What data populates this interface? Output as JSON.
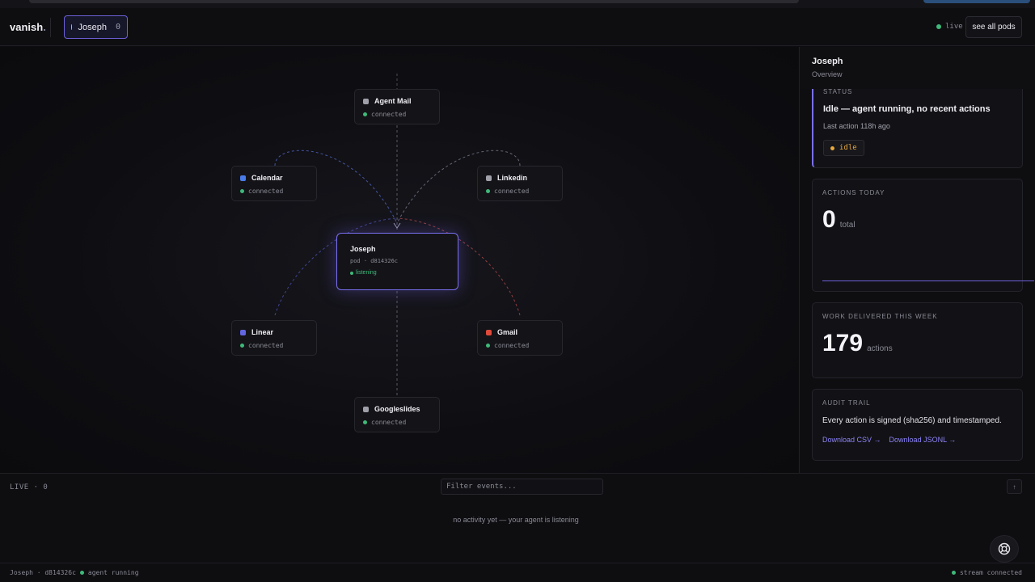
{
  "header": {
    "logo": "vanish",
    "logo_dot": ".",
    "pod_name": "Joseph",
    "pod_count": "0",
    "live_label": "live",
    "see_all_label": "see all pods"
  },
  "graph": {
    "center": {
      "title": "Joseph",
      "subtitle": "pod · d814326c",
      "state": "listening"
    },
    "nodes": [
      {
        "name": "Agent Mail",
        "status": "connected",
        "color": "#a0a0aa"
      },
      {
        "name": "Calendar",
        "status": "connected",
        "color": "#4a7ce8"
      },
      {
        "name": "Linkedin",
        "status": "connected",
        "color": "#a0a0aa"
      },
      {
        "name": "Linear",
        "status": "connected",
        "color": "#6266e0"
      },
      {
        "name": "Gmail",
        "status": "connected",
        "color": "#e04a3a"
      },
      {
        "name": "Googleslides",
        "status": "connected",
        "color": "#a0a0aa"
      }
    ]
  },
  "panel": {
    "title": "Joseph",
    "subtitle": "Overview",
    "status": {
      "label": "STATUS",
      "headline": "Idle — agent running, no recent actions",
      "last_action": "Last action 118h ago",
      "badge": "idle"
    },
    "actions_today": {
      "label": "ACTIONS TODAY",
      "value": "0",
      "unit": "total"
    },
    "work_week": {
      "label": "WORK DELIVERED THIS WEEK",
      "value": "179",
      "unit": "actions"
    },
    "audit": {
      "label": "AUDIT TRAIL",
      "text": "Every action is signed (sha256) and timestamped.",
      "csv_link": "Download CSV →",
      "jsonl_link": "Download JSONL →"
    }
  },
  "events": {
    "label": "LIVE · 0",
    "filter_placeholder": "Filter events...",
    "scroll_top": "↑",
    "empty": "no activity yet — your agent is listening"
  },
  "statusbar": {
    "pod": "Joseph · d814326c",
    "agent": "agent running",
    "stream": "stream connected"
  },
  "colors": {
    "accent": "#7a6ff0",
    "connected": "#3fb97a",
    "idle": "#e8a93a"
  }
}
